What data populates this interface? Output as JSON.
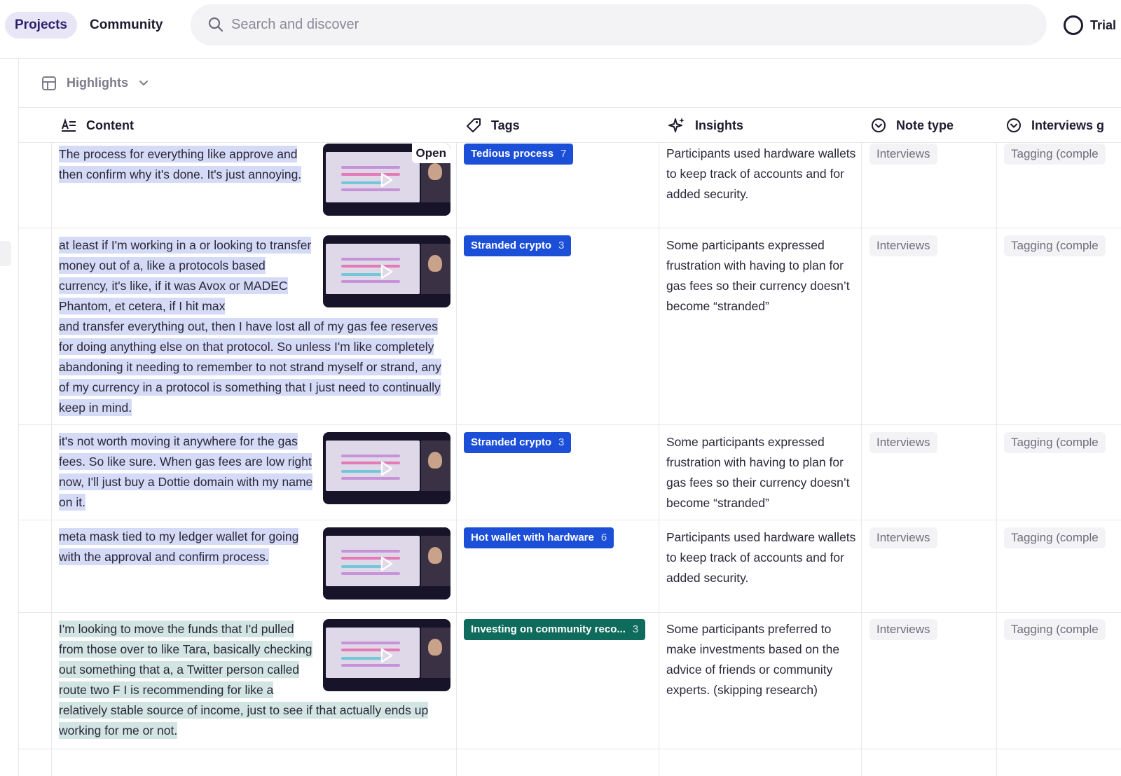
{
  "topbar": {
    "tabs": [
      {
        "label": "Projects",
        "active": true
      },
      {
        "label": "Community",
        "active": false
      }
    ],
    "search_placeholder": "Search and discover",
    "trial_label": "Trial"
  },
  "view": {
    "label": "Highlights"
  },
  "columns": {
    "content": "Content",
    "tags": "Tags",
    "insights": "Insights",
    "note_type": "Note type",
    "interviews": "Interviews g"
  },
  "rows": [
    {
      "content": "The process for everything like approve and then confirm why it's done. It's just annoying.",
      "open_label": "Open",
      "tag": {
        "label": "Tedious process",
        "count": "7",
        "color": "#1c4fd8"
      },
      "insight": "Participants used hardware wallets to keep track of accounts and for added security.",
      "note_type": "Interviews",
      "interviews": "Tagging (comple"
    },
    {
      "content": "at least if I'm working in a or looking to transfer money out of a, like a protocols based currency, it's like, if it was Avox or MADEC Phantom, et cetera, if I hit max and transfer everything out, then I have lost all of my gas fee reserves for doing anything else on that protocol. So unless I'm like completely abandoning it needing to remember to not strand myself or strand, any of my currency in a protocol is something that I just need to continually keep in mind.",
      "tag": {
        "label": "Stranded crypto",
        "count": "3",
        "color": "#1c4fd8"
      },
      "insight": "Some participants expressed frustration with having to plan for gas fees so their currency doesn’t become “stranded”",
      "note_type": "Interviews",
      "interviews": "Tagging (comple"
    },
    {
      "content": "it's not worth moving it anywhere for the gas fees. So like sure. When gas fees are low right now, I'll just buy a Dottie domain with my name on it.",
      "tag": {
        "label": "Stranded crypto",
        "count": "3",
        "color": "#1c4fd8"
      },
      "insight": "Some participants expressed frustration with having to plan for gas fees so their currency doesn’t become “stranded”",
      "note_type": "Interviews",
      "interviews": "Tagging (comple"
    },
    {
      "content": "meta mask tied to my ledger wallet for going with the approval and confirm process.",
      "tag": {
        "label": "Hot wallet with hardware",
        "count": "6",
        "color": "#1c4fd8"
      },
      "insight": "Participants used hardware wallets to keep track of accounts and for added security.",
      "note_type": "Interviews",
      "interviews": "Tagging (comple"
    },
    {
      "content": "I'm looking to move the funds that I'd pulled from those over to like Tara, basically checking out something that a, a Twitter person called route two F I is recommending for like a relatively stable source of income, just to see if that actually ends up working for me or not.",
      "tag": {
        "label": "Investing on community reco...",
        "count": "3",
        "color": "#0f6b5c"
      },
      "insight": "Some participants preferred to make investments based on the advice of friends or community experts. (skipping research)",
      "note_type": "Interviews",
      "interviews": "Tagging (comple"
    }
  ]
}
